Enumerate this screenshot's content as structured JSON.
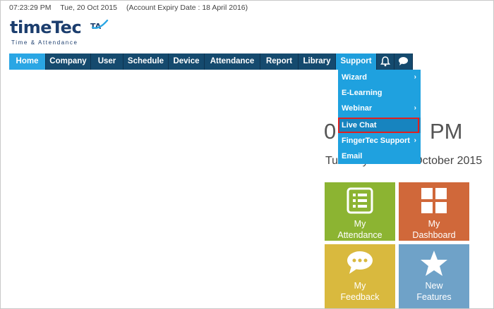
{
  "status": {
    "time": "07:23:29 PM",
    "date": "Tue, 20 Oct 2015",
    "expiry": "(Account Expiry Date : 18 April 2016)"
  },
  "logo": {
    "brand": "timeTec",
    "suffix": "TA",
    "tagline": "Time & Attendance"
  },
  "nav": {
    "items": [
      "Home",
      "Company",
      "User",
      "Schedule",
      "Device",
      "Attendance",
      "Report",
      "Library",
      "Support"
    ]
  },
  "support_menu": {
    "items": [
      {
        "label": "Wizard",
        "submenu": true
      },
      {
        "label": "E-Learning",
        "submenu": false
      },
      {
        "label": "Webinar",
        "submenu": true
      },
      {
        "label": "Live Chat",
        "submenu": false
      },
      {
        "label": "FingerTec Support",
        "submenu": true
      },
      {
        "label": "Email",
        "submenu": false
      }
    ]
  },
  "clock": {
    "left": "0",
    "right": "PM",
    "date_left": "Tuesday",
    "date_right": "October 2015"
  },
  "tiles": {
    "attendance": [
      "My",
      "Attendance"
    ],
    "dashboard": [
      "My",
      "Dashboard"
    ],
    "feedback": [
      "My",
      "Feedback"
    ],
    "features": [
      "New",
      "Features"
    ]
  },
  "colors": {
    "nav_dark": "#154a6e",
    "nav_active": "#2aa6e4",
    "dropdown": "#1fa1df",
    "highlight": "#e02020",
    "tile_attendance": "#8cb432",
    "tile_dashboard": "#d0683a",
    "tile_feedback": "#d9b93e",
    "tile_features": "#6fa2c8"
  },
  "icons": {
    "bell": "bell-icon",
    "chat": "chat-icon",
    "attendance": "checklist-icon",
    "dashboard": "grid-icon",
    "feedback": "speech-bubble-icon",
    "features": "star-icon"
  }
}
